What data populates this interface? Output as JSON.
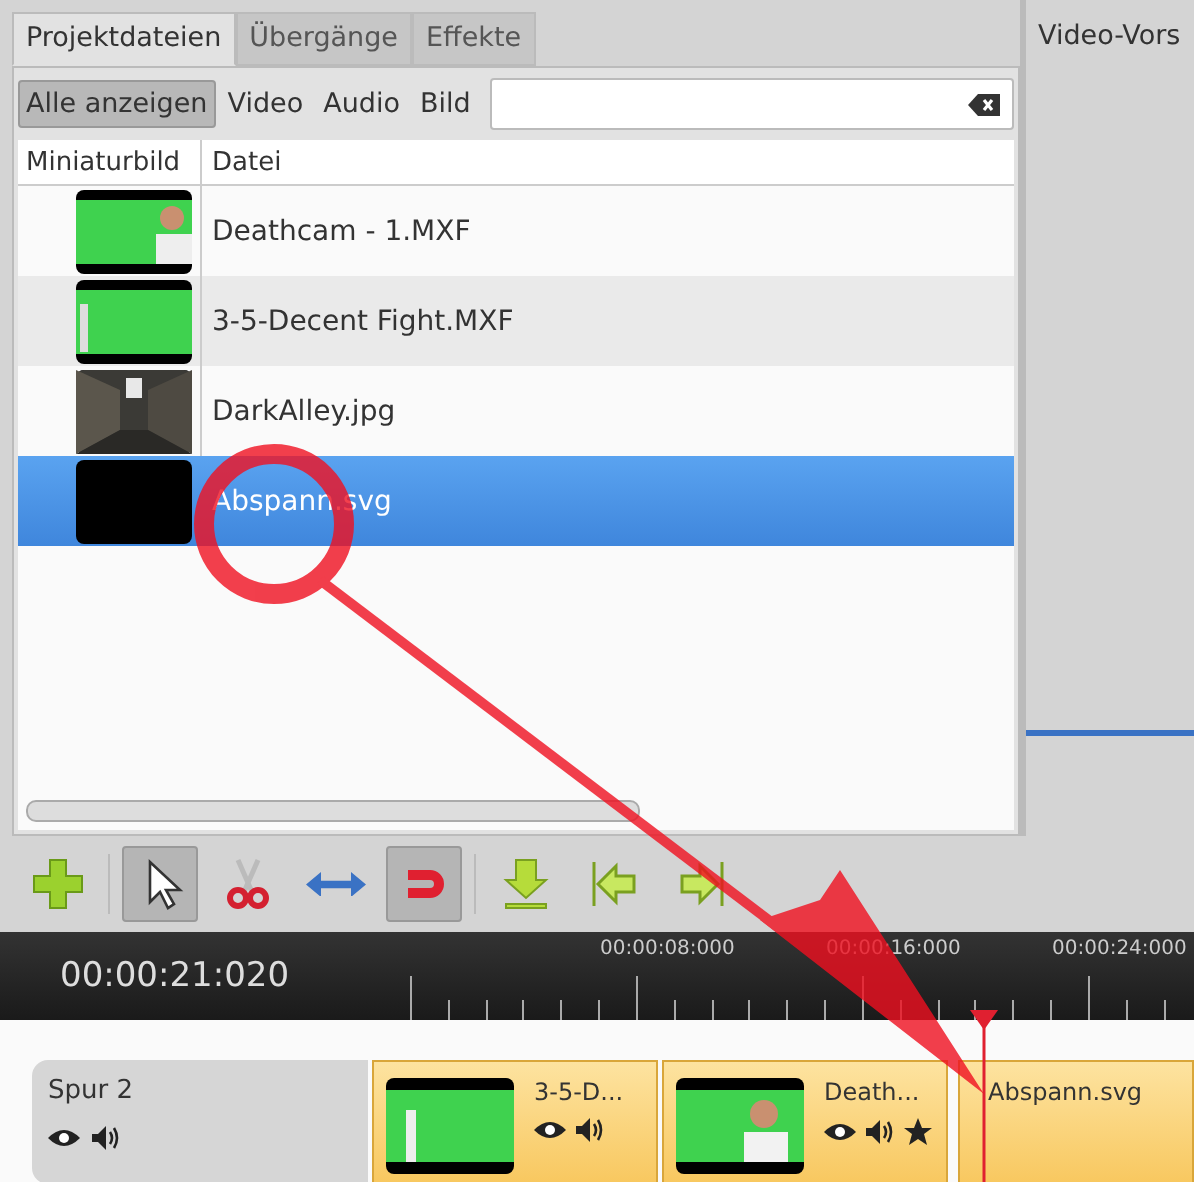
{
  "tabs": [
    {
      "label": "Projektdateien",
      "selected": true
    },
    {
      "label": "Übergänge",
      "selected": false
    },
    {
      "label": "Effekte",
      "selected": false
    }
  ],
  "filters": [
    {
      "label": "Alle anzeigen",
      "selected": true
    },
    {
      "label": "Video",
      "selected": false
    },
    {
      "label": "Audio",
      "selected": false
    },
    {
      "label": "Bild",
      "selected": false
    }
  ],
  "file_table": {
    "columns": [
      "Miniaturbild",
      "Datei"
    ],
    "rows": [
      {
        "file": "Deathcam - 1.MXF",
        "selected": false
      },
      {
        "file": "3-5-Decent Fight.MXF",
        "selected": false
      },
      {
        "file": "DarkAlley.jpg",
        "selected": false
      },
      {
        "file": "Abspann.svg",
        "selected": true
      }
    ]
  },
  "preview": {
    "title": "Video-Vors"
  },
  "tools": [
    {
      "kind": "add",
      "on": false
    },
    {
      "kind": "pointer",
      "on": true
    },
    {
      "kind": "razor",
      "on": false
    },
    {
      "kind": "resize",
      "on": false
    },
    {
      "kind": "snap",
      "on": true
    },
    {
      "kind": "marker",
      "on": false
    },
    {
      "kind": "previous",
      "on": false
    },
    {
      "kind": "next",
      "on": false
    }
  ],
  "timeline": {
    "time": "00:00:21:020",
    "ticks": [
      "00:00:08:000",
      "00:00:16:000",
      "00:00:24:000"
    ]
  },
  "track": {
    "name": "Spur 2",
    "clips": [
      {
        "title": "3-5-D...",
        "kind": "video",
        "favorite": false
      },
      {
        "title": "Death...",
        "kind": "video",
        "favorite": true
      },
      {
        "title": "Abspann.svg",
        "favorite": false
      }
    ]
  }
}
